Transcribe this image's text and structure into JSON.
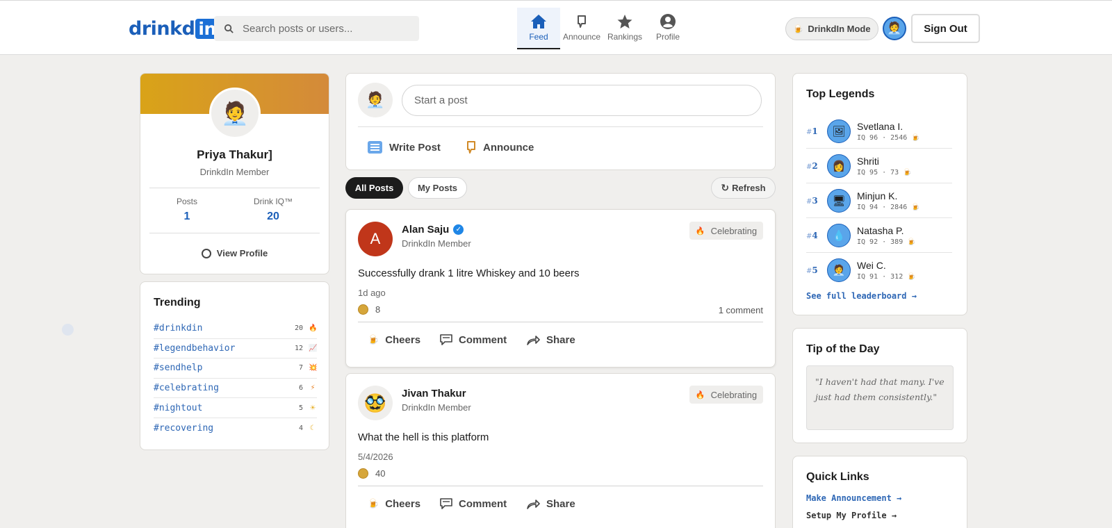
{
  "header": {
    "logo_text": "drinkd",
    "logo_in": "in",
    "search_placeholder": "Search posts or users...",
    "nav": [
      {
        "label": "Feed",
        "icon": "home-icon",
        "active": true
      },
      {
        "label": "Announce",
        "icon": "megaphone-icon",
        "active": false
      },
      {
        "label": "Rankings",
        "icon": "star-icon",
        "active": false
      },
      {
        "label": "Profile",
        "icon": "user-circle-icon",
        "active": false
      }
    ],
    "mode_label": "DrinkdIn Mode",
    "signout_label": "Sign Out"
  },
  "profile": {
    "name": "Priya Thakur]",
    "subtitle": "DrinkdIn Member",
    "stats": [
      {
        "label": "Posts",
        "value": "1"
      },
      {
        "label": "Drink IQ™",
        "value": "20"
      }
    ],
    "view_label": "View Profile"
  },
  "trending": {
    "title": "Trending",
    "items": [
      {
        "tag": "#drinkdin",
        "count": "20",
        "icon": "fire-icon"
      },
      {
        "tag": "#legendbehavior",
        "count": "12",
        "icon": "chart-icon"
      },
      {
        "tag": "#sendhelp",
        "count": "7",
        "icon": "burst-icon"
      },
      {
        "tag": "#celebrating",
        "count": "6",
        "icon": "bolt-icon"
      },
      {
        "tag": "#nightout",
        "count": "5",
        "icon": "sun-icon"
      },
      {
        "tag": "#recovering",
        "count": "4",
        "icon": "moon-icon"
      }
    ]
  },
  "composer": {
    "placeholder": "Start a post",
    "write_label": "Write Post",
    "announce_label": "Announce"
  },
  "filters": {
    "all_label": "All Posts",
    "mine_label": "My Posts",
    "refresh_label": "Refresh"
  },
  "posts": [
    {
      "avatar_letter": "A",
      "author": "Alan Saju",
      "verified": true,
      "subtitle": "DrinkdIn Member",
      "badge": "Celebrating",
      "text": "Successfully drank 1 litre Whiskey and 10 beers",
      "time": "1d ago",
      "cheers": "8",
      "comments": "1 comment",
      "actions": {
        "cheers": "Cheers",
        "comment": "Comment",
        "share": "Share"
      }
    },
    {
      "avatar_letter": "",
      "author": "Jivan Thakur",
      "verified": false,
      "subtitle": "DrinkdIn Member",
      "badge": "Celebrating",
      "text": "What the hell is this platform",
      "time": "5/4/2026",
      "cheers": "40",
      "comments": "",
      "actions": {
        "cheers": "Cheers",
        "comment": "Comment",
        "share": "Share"
      }
    }
  ],
  "legends": {
    "title": "Top Legends",
    "items": [
      {
        "rank": "1",
        "name": "Svetlana I.",
        "stats": "IQ 96 · 2546"
      },
      {
        "rank": "2",
        "name": "Shriti",
        "stats": "IQ 95 · 73"
      },
      {
        "rank": "3",
        "name": "Minjun K.",
        "stats": "IQ 94 · 2846"
      },
      {
        "rank": "4",
        "name": "Natasha P.",
        "stats": "IQ 92 · 389"
      },
      {
        "rank": "5",
        "name": "Wei C.",
        "stats": "IQ 91 · 312"
      }
    ],
    "link": "See full leaderboard →"
  },
  "tip": {
    "title": "Tip of the Day",
    "quote": "\"I haven't had that many. I've just had them consistently.\""
  },
  "quick_links": {
    "title": "Quick Links",
    "links": [
      "Make Announcement →",
      "Setup My Profile →"
    ]
  },
  "colors": {
    "brand": "#1b5fb9",
    "link": "#2e67b5",
    "avatar_red": "#c0361a",
    "banner_start": "#d9a318",
    "banner_end": "#d48a3a"
  }
}
